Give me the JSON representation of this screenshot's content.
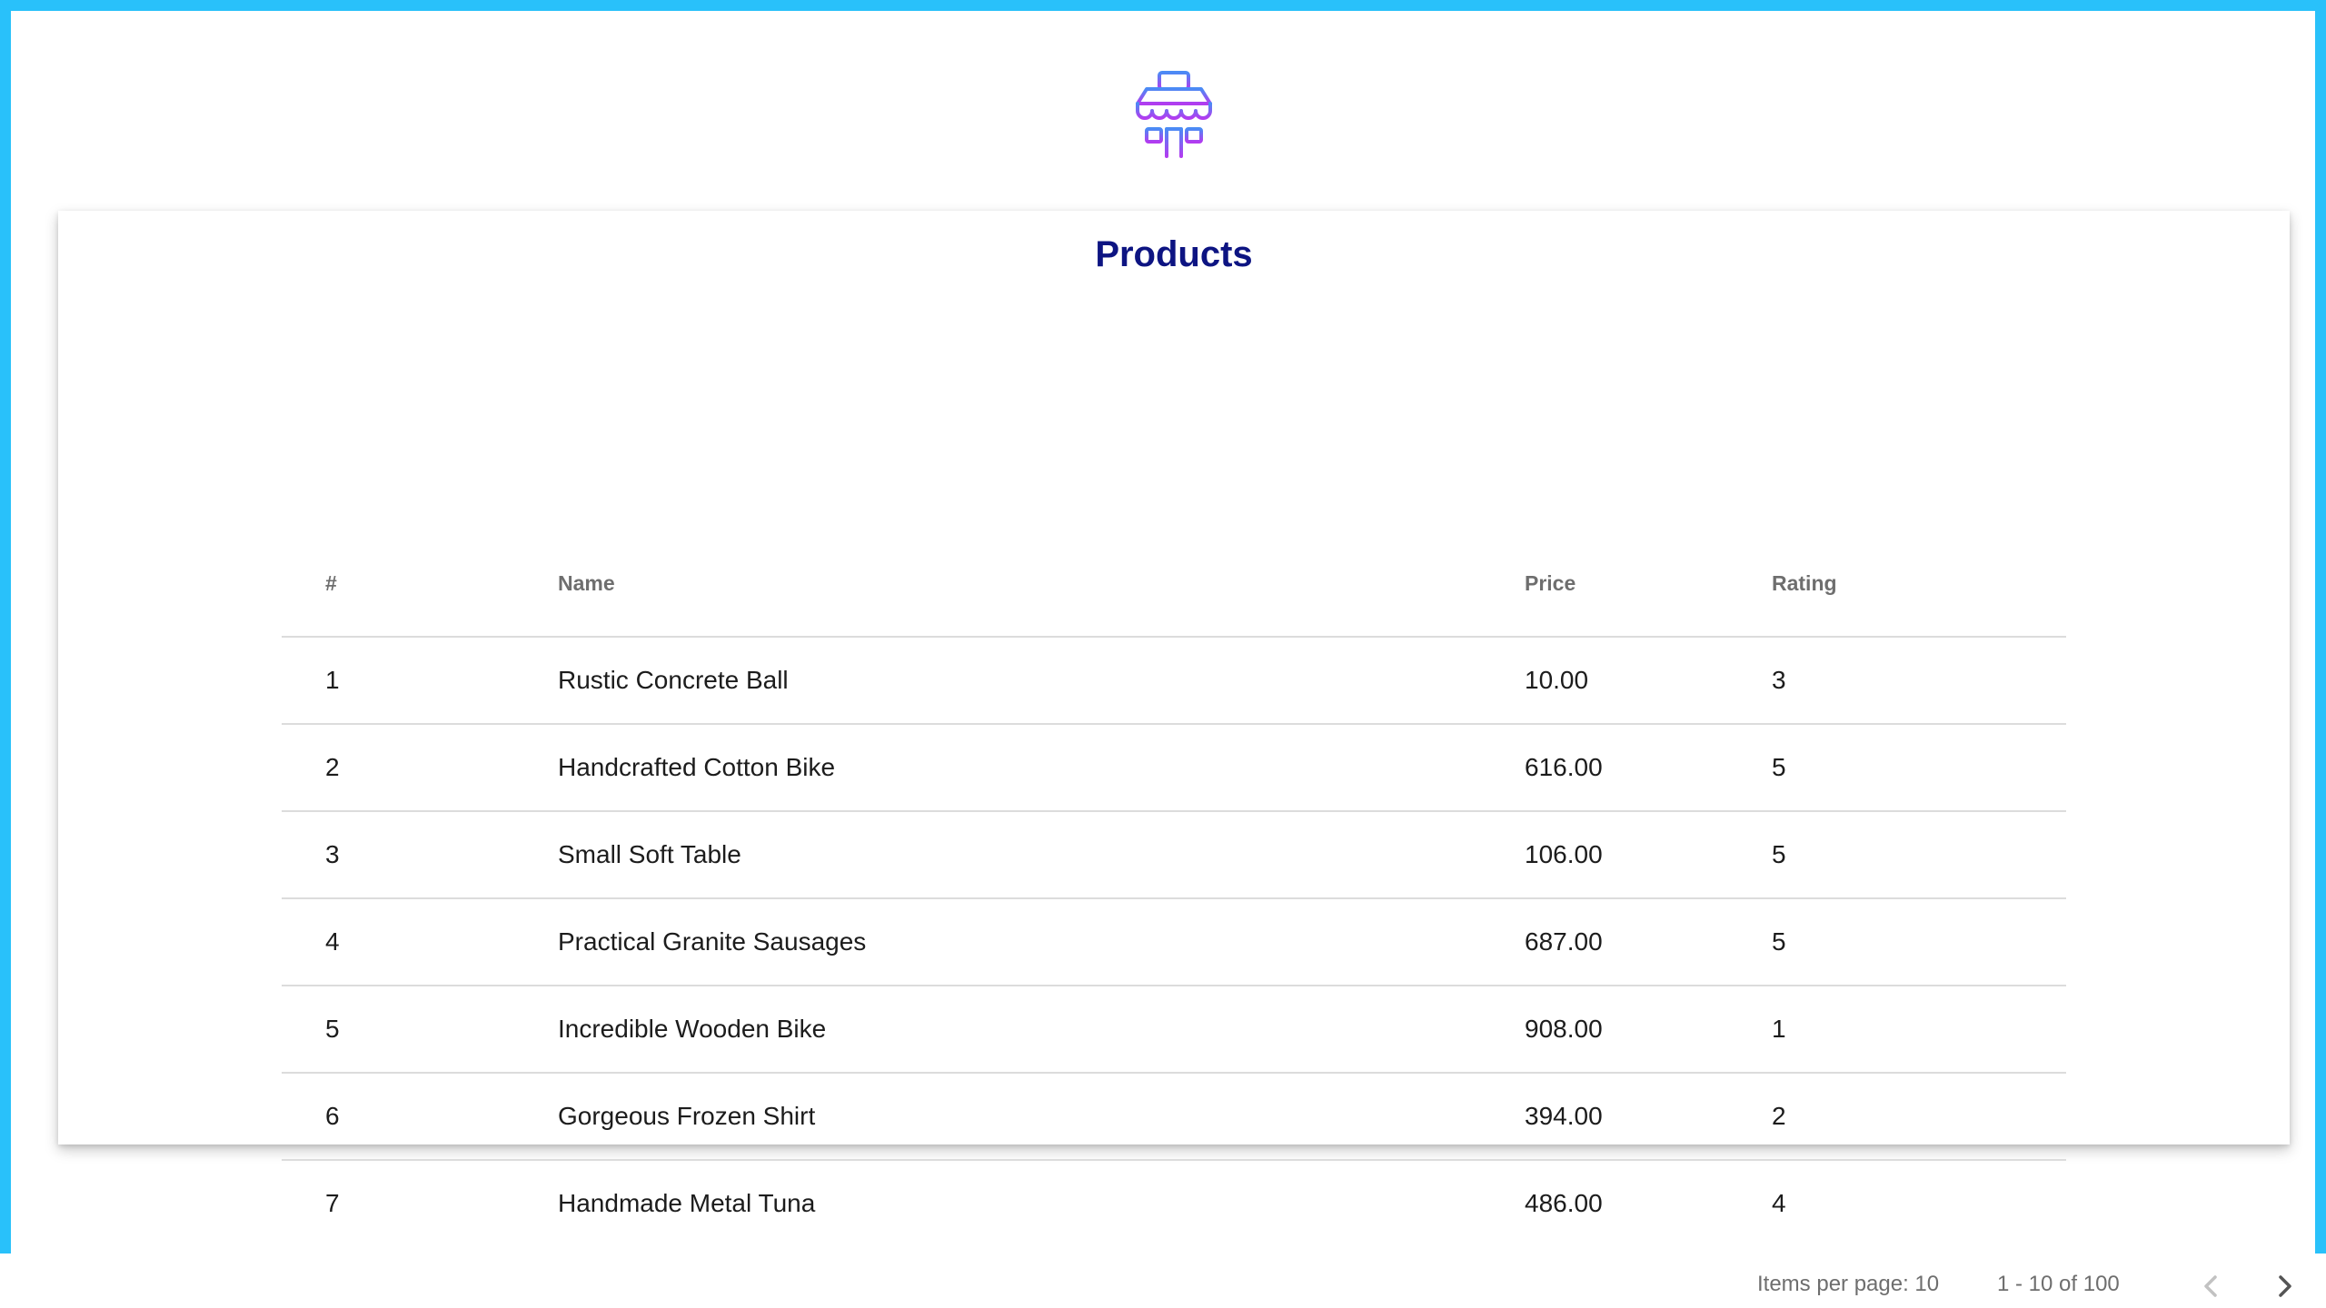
{
  "colors": {
    "frame": "#29c1fa",
    "title": "#0d1482",
    "logo_gradient_start": "#4b8bf5",
    "logo_gradient_end": "#b23cf0"
  },
  "logo": {
    "icon": "store-icon"
  },
  "card": {
    "title": "Products"
  },
  "table": {
    "columns": [
      "#",
      "Name",
      "Price",
      "Rating"
    ],
    "rows": [
      {
        "num": "1",
        "name": "Rustic Concrete Ball",
        "price": "10.00",
        "rating": "3"
      },
      {
        "num": "2",
        "name": "Handcrafted Cotton Bike",
        "price": "616.00",
        "rating": "5"
      },
      {
        "num": "3",
        "name": "Small Soft Table",
        "price": "106.00",
        "rating": "5"
      },
      {
        "num": "4",
        "name": "Practical Granite Sausages",
        "price": "687.00",
        "rating": "5"
      },
      {
        "num": "5",
        "name": "Incredible Wooden Bike",
        "price": "908.00",
        "rating": "1"
      },
      {
        "num": "6",
        "name": "Gorgeous Frozen Shirt",
        "price": "394.00",
        "rating": "2"
      },
      {
        "num": "7",
        "name": "Handmade Metal Tuna",
        "price": "486.00",
        "rating": "4"
      }
    ]
  },
  "pagination": {
    "items_per_page_label": "Items per page: 10",
    "range_label": "1 - 10 of 100",
    "prev_icon": "chevron-left-icon",
    "next_icon": "chevron-right-icon"
  }
}
